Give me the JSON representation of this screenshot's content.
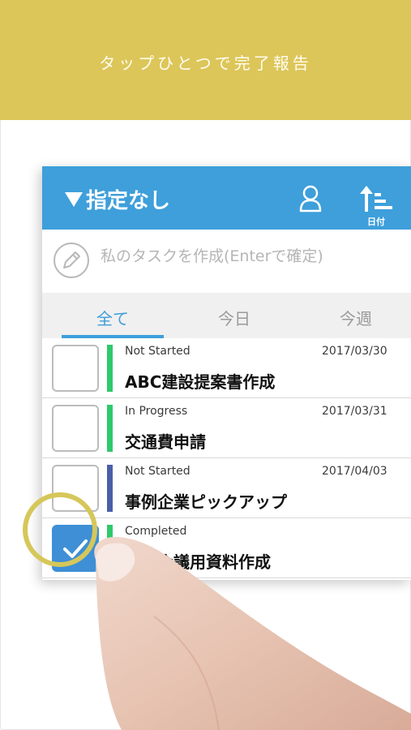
{
  "banner": {
    "caption": "タップひとつで完了報告"
  },
  "header": {
    "filter_label": "指定なし",
    "user_icon": "person-icon",
    "sort_icon": "sort-ascending-icon",
    "sort_label": "日付"
  },
  "new_task": {
    "icon": "pencil-icon",
    "placeholder": "私のタスクを作成(Enterで確定)"
  },
  "tabs": [
    {
      "label": "全て",
      "active": true
    },
    {
      "label": "今日",
      "active": false
    },
    {
      "label": "今週",
      "active": false
    }
  ],
  "tasks": [
    {
      "status": "Not Started",
      "date": "2017/03/30",
      "title": "ABC建設提案書作成",
      "color": "#2ec96b",
      "checked": false
    },
    {
      "status": "In Progress",
      "date": "2017/03/31",
      "title": "交通費申請",
      "color": "#2ec96b",
      "checked": false
    },
    {
      "status": "Not Started",
      "date": "2017/04/03",
      "title": "事例企業ピックアップ",
      "color": "#4a5fa8",
      "checked": false
    },
    {
      "status": "Completed",
      "date": "",
      "title": "月例会議用資料作成",
      "color": "#2ec96b",
      "checked": true
    }
  ],
  "colors": {
    "banner": "#dcc65a",
    "accent": "#3e9fdb",
    "highlight_ring": "#d6c75a"
  }
}
